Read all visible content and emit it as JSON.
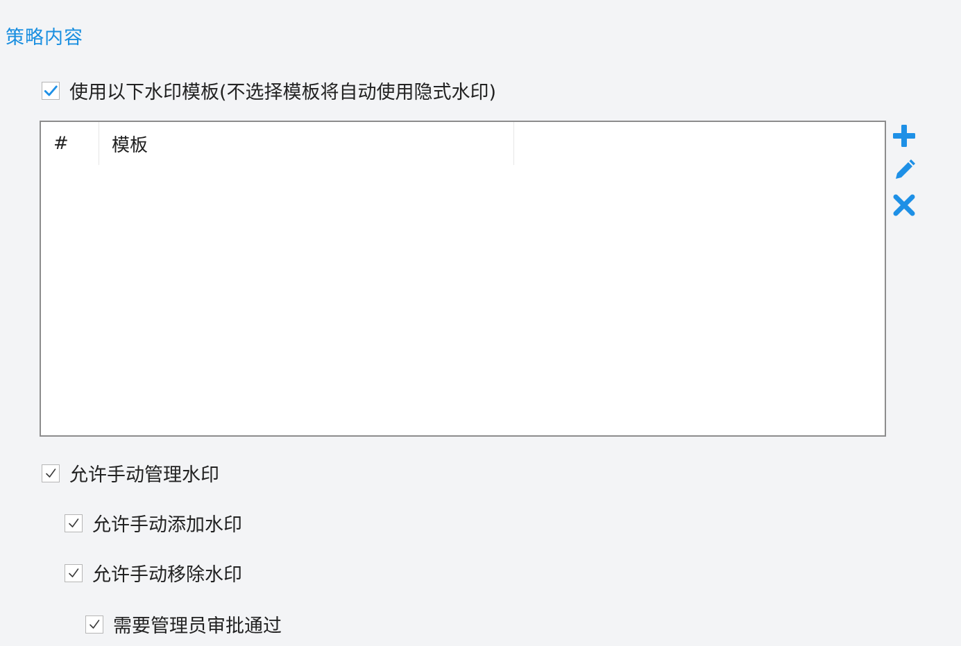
{
  "section": {
    "title": "策略内容"
  },
  "options": {
    "use_template": {
      "label": "使用以下水印模板(不选择模板将自动使用隐式水印)",
      "checked": true
    },
    "allow_manual_manage": {
      "label": "允许手动管理水印",
      "checked": true
    },
    "allow_manual_add": {
      "label": "允许手动添加水印",
      "checked": true
    },
    "allow_manual_remove": {
      "label": "允许手动移除水印",
      "checked": true
    },
    "require_admin_approval": {
      "label": "需要管理员审批通过",
      "checked": true
    }
  },
  "template_table": {
    "columns": [
      "#",
      "模板",
      ""
    ],
    "rows": []
  },
  "tools": {
    "add_icon": "plus-icon",
    "edit_icon": "pencil-icon",
    "delete_icon": "close-icon"
  },
  "colors": {
    "accent": "#1a8fe0",
    "check_blue": "#1e90e6",
    "check_gray": "#3a3a3a"
  }
}
